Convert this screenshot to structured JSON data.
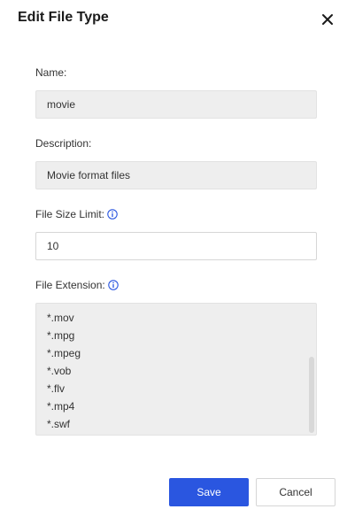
{
  "dialog": {
    "title": "Edit File Type",
    "close_icon": "close-icon"
  },
  "name": {
    "label": "Name:",
    "value": "movie"
  },
  "description": {
    "label": "Description:",
    "value": "Movie format files"
  },
  "size_limit": {
    "label": "File Size Limit:",
    "info_icon": "info-icon",
    "value": "10"
  },
  "extension": {
    "label": "File Extension:",
    "info_icon": "info-icon",
    "items": [
      "*.mov",
      "*.mpg",
      "*.mpeg",
      "*.vob",
      "*.flv",
      "*.mp4",
      "*.swf"
    ]
  },
  "footer": {
    "save_label": "Save",
    "cancel_label": "Cancel"
  },
  "colors": {
    "primary": "#2a56e0",
    "info": "#2a56e0",
    "readonly_bg": "#eeeeee"
  }
}
